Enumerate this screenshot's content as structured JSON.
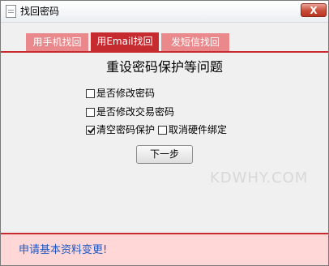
{
  "window": {
    "title": "找回密码",
    "close_symbol": "X",
    "title_icon": "document-icon",
    "close_icon": "close-icon"
  },
  "tabs": [
    {
      "label": "用手机找回",
      "active": false
    },
    {
      "label": "用Email找回",
      "active": true
    },
    {
      "label": "发短信找回",
      "active": false
    }
  ],
  "main": {
    "heading": "重设密码保护等问题",
    "checkboxes": [
      {
        "label": "是否修改密码",
        "checked": false
      },
      {
        "label": "是否修改交易密码",
        "checked": false
      },
      {
        "label": "清空密码保护",
        "checked": true
      },
      {
        "label": "取消硬件绑定",
        "checked": false
      }
    ],
    "next_button": "下一步",
    "watermark": "KDWHY.COM"
  },
  "footer": {
    "link_text": "申请基本资料变更!"
  },
  "colors": {
    "accent": "#c62b30",
    "tab_inactive": "#e9898c",
    "footer_bg": "#ffd7d7",
    "link": "#1b56c4",
    "close_button": "#c94c39"
  }
}
